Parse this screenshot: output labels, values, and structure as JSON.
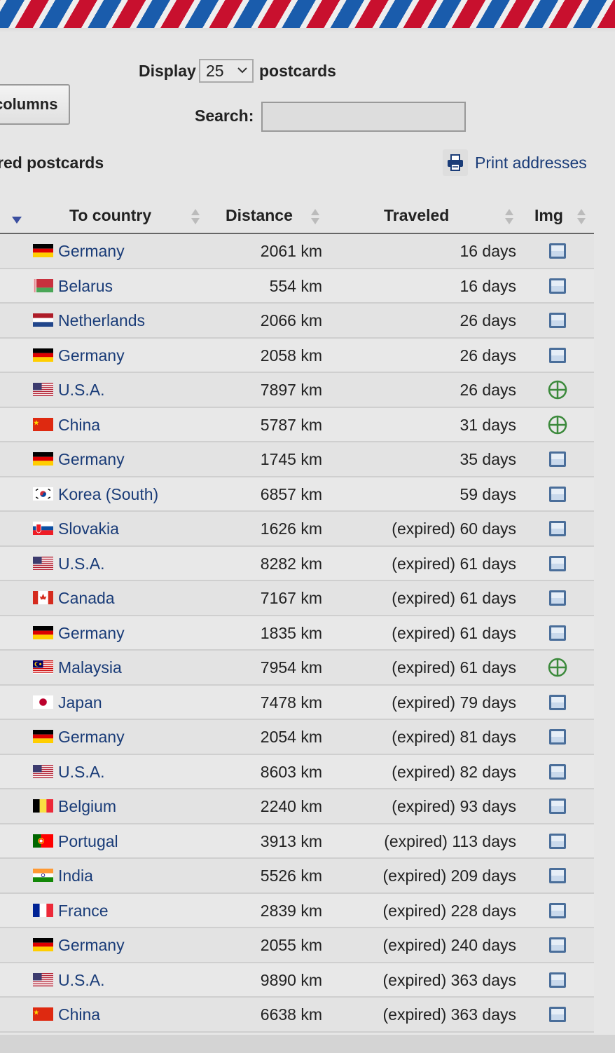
{
  "controls": {
    "display_label": "Display",
    "display_value": "25",
    "postcards_label": "postcards",
    "columns_button": "columns",
    "search_label": "Search:",
    "search_value": "",
    "section_title": "red postcards",
    "print_addresses": "Print addresses"
  },
  "table": {
    "headers": {
      "to_country": "To country",
      "distance": "Distance",
      "traveled": "Traveled",
      "img": "Img"
    },
    "rows": [
      {
        "country": "Germany",
        "flag": "de",
        "distance": "2061 km",
        "traveled": "16 days",
        "img": "image-icon"
      },
      {
        "country": "Belarus",
        "flag": "by",
        "distance": "554 km",
        "traveled": "16 days",
        "img": "image-icon"
      },
      {
        "country": "Netherlands",
        "flag": "nl",
        "distance": "2066 km",
        "traveled": "26 days",
        "img": "image-icon"
      },
      {
        "country": "Germany",
        "flag": "de",
        "distance": "2058 km",
        "traveled": "26 days",
        "img": "image-icon"
      },
      {
        "country": "U.S.A.",
        "flag": "us",
        "distance": "7897 km",
        "traveled": "26 days",
        "img": "add-image-icon"
      },
      {
        "country": "China",
        "flag": "cn",
        "distance": "5787 km",
        "traveled": "31 days",
        "img": "add-image-icon"
      },
      {
        "country": "Germany",
        "flag": "de",
        "distance": "1745 km",
        "traveled": "35 days",
        "img": "image-icon"
      },
      {
        "country": "Korea (South)",
        "flag": "kr",
        "distance": "6857 km",
        "traveled": "59 days",
        "img": "image-icon"
      },
      {
        "country": "Slovakia",
        "flag": "sk",
        "distance": "1626 km",
        "traveled": "(expired) 60 days",
        "img": "image-icon"
      },
      {
        "country": "U.S.A.",
        "flag": "us",
        "distance": "8282 km",
        "traveled": "(expired) 61 days",
        "img": "image-icon"
      },
      {
        "country": "Canada",
        "flag": "ca",
        "distance": "7167 km",
        "traveled": "(expired) 61 days",
        "img": "image-icon"
      },
      {
        "country": "Germany",
        "flag": "de",
        "distance": "1835 km",
        "traveled": "(expired) 61 days",
        "img": "image-icon"
      },
      {
        "country": "Malaysia",
        "flag": "my",
        "distance": "7954 km",
        "traveled": "(expired) 61 days",
        "img": "add-image-icon"
      },
      {
        "country": "Japan",
        "flag": "jp",
        "distance": "7478 km",
        "traveled": "(expired) 79 days",
        "img": "image-icon"
      },
      {
        "country": "Germany",
        "flag": "de",
        "distance": "2054 km",
        "traveled": "(expired) 81 days",
        "img": "image-icon"
      },
      {
        "country": "U.S.A.",
        "flag": "us",
        "distance": "8603 km",
        "traveled": "(expired) 82 days",
        "img": "image-icon"
      },
      {
        "country": "Belgium",
        "flag": "be",
        "distance": "2240 km",
        "traveled": "(expired) 93 days",
        "img": "image-icon"
      },
      {
        "country": "Portugal",
        "flag": "pt",
        "distance": "3913 km",
        "traveled": "(expired) 113 days",
        "img": "image-icon"
      },
      {
        "country": "India",
        "flag": "in",
        "distance": "5526 km",
        "traveled": "(expired) 209 days",
        "img": "image-icon"
      },
      {
        "country": "France",
        "flag": "fr",
        "distance": "2839 km",
        "traveled": "(expired) 228 days",
        "img": "image-icon"
      },
      {
        "country": "Germany",
        "flag": "de",
        "distance": "2055 km",
        "traveled": "(expired) 240 days",
        "img": "image-icon"
      },
      {
        "country": "U.S.A.",
        "flag": "us",
        "distance": "9890 km",
        "traveled": "(expired) 363 days",
        "img": "image-icon"
      },
      {
        "country": "China",
        "flag": "cn",
        "distance": "6638 km",
        "traveled": "(expired) 363 days",
        "img": "image-icon"
      }
    ]
  },
  "colors": {
    "link": "#1a3c78",
    "airmail_red": "#c8102e",
    "airmail_blue": "#1a5cac",
    "add_icon_green": "#3c8a3c",
    "image_icon_blue": "#4a6e9a"
  }
}
